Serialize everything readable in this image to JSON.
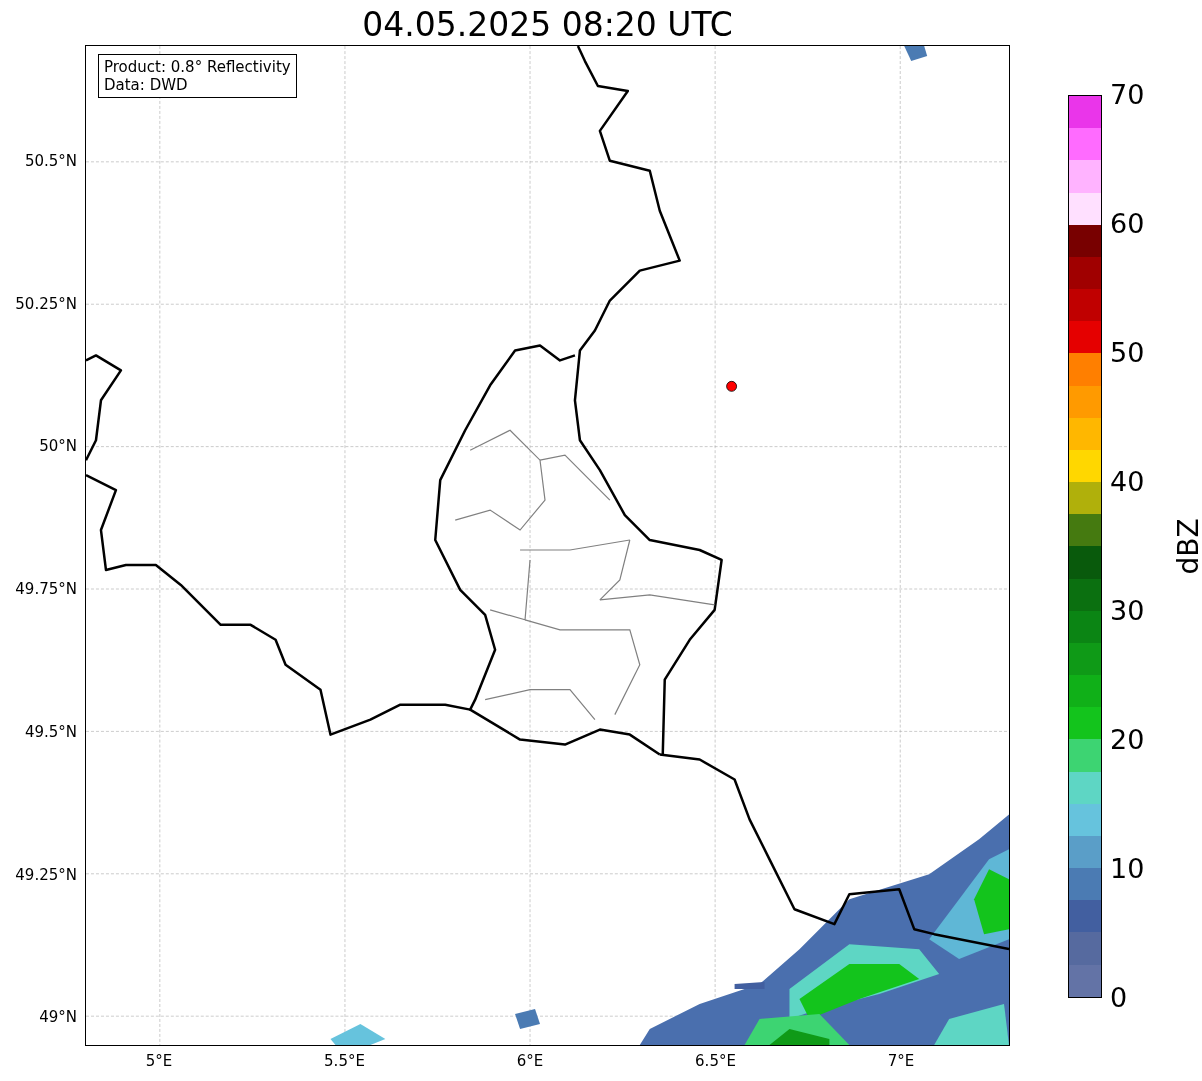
{
  "title": "04.05.2025 08:20 UTC",
  "info": [
    "Product: 0.8° Reflectivity",
    "Data: DWD"
  ],
  "x_ticks": [
    "5°E",
    "5.5°E",
    "6°E",
    "6.5°E",
    "7°E"
  ],
  "y_ticks": [
    "50.5°N",
    "50.25°N",
    "50°N",
    "49.75°N",
    "49.5°N",
    "49.25°N",
    "49°N"
  ],
  "colorbar": {
    "label": "dBZ",
    "ticks": [
      "70",
      "60",
      "50",
      "40",
      "30",
      "20",
      "10",
      "0"
    ],
    "bands": [
      {
        "color": "#ea35ea"
      },
      {
        "color": "#ff6bff"
      },
      {
        "color": "#ffb3ff"
      },
      {
        "color": "#ffe0ff"
      },
      {
        "color": "#780000"
      },
      {
        "color": "#a00000"
      },
      {
        "color": "#c00000"
      },
      {
        "color": "#e50000"
      },
      {
        "color": "#ff7f00"
      },
      {
        "color": "#ff9a00"
      },
      {
        "color": "#ffb700"
      },
      {
        "color": "#ffd700"
      },
      {
        "color": "#b0b00b"
      },
      {
        "color": "#457a10"
      },
      {
        "color": "#095a0c"
      },
      {
        "color": "#0b7010"
      },
      {
        "color": "#0b8514"
      },
      {
        "color": "#0f9a17"
      },
      {
        "color": "#10b018"
      },
      {
        "color": "#13c41c"
      },
      {
        "color": "#3dd472"
      },
      {
        "color": "#5ed6c4"
      },
      {
        "color": "#66c3dd"
      },
      {
        "color": "#5a9ec8"
      },
      {
        "color": "#4b7bb3"
      },
      {
        "color": "#425fa0"
      },
      {
        "color": "#566a9f"
      },
      {
        "color": "#6373a6"
      }
    ]
  }
}
